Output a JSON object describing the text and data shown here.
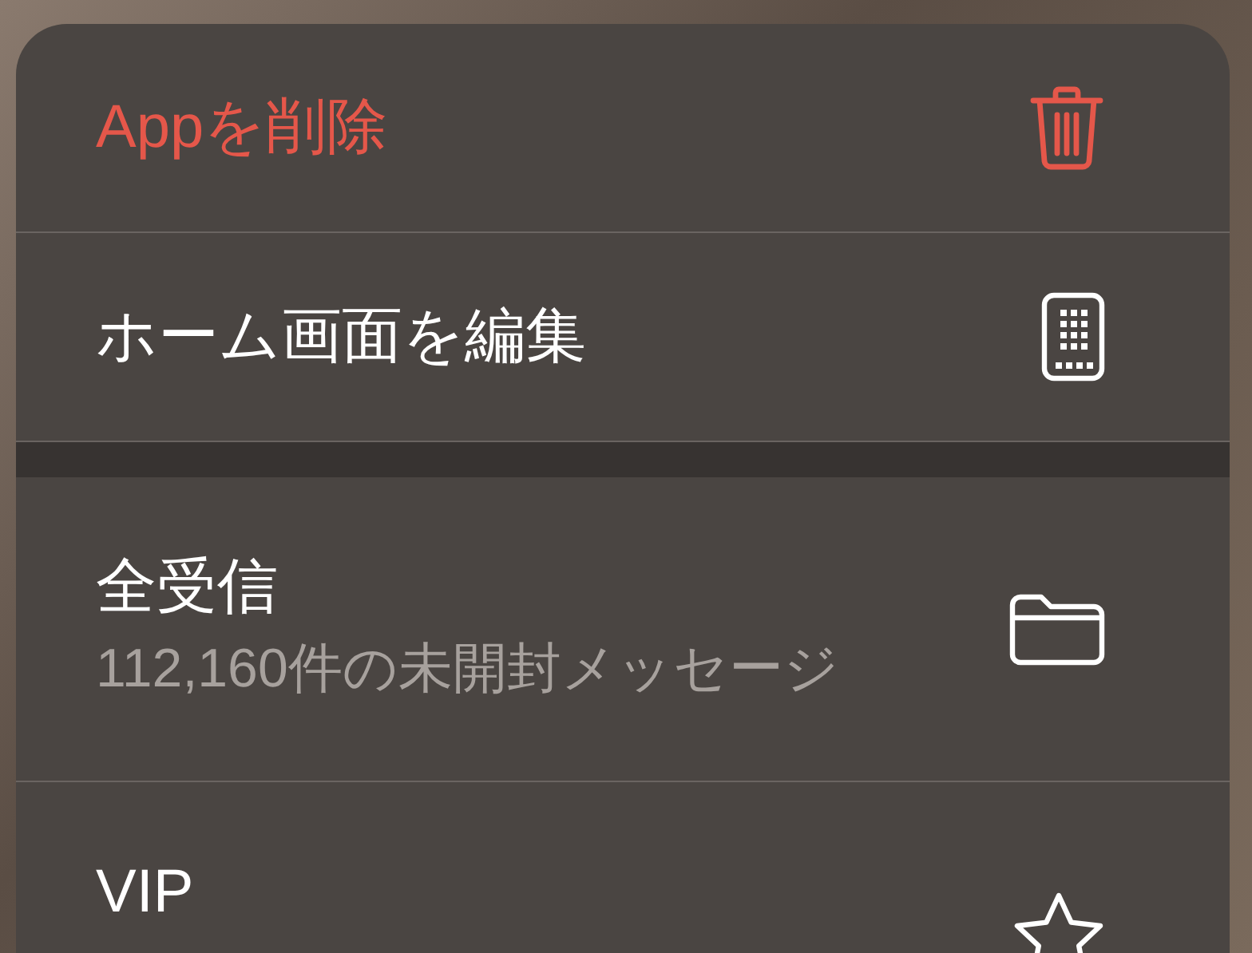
{
  "menu": {
    "sections": [
      {
        "items": [
          {
            "label": "Appを削除",
            "kind": "destructive"
          },
          {
            "label": "ホーム画面を編集",
            "kind": "default"
          }
        ]
      },
      {
        "items": [
          {
            "label": "全受信",
            "subtitle": "112,160件の未開封メッセージ",
            "kind": "default"
          },
          {
            "label": "VIP",
            "kind": "default"
          }
        ]
      }
    ]
  }
}
